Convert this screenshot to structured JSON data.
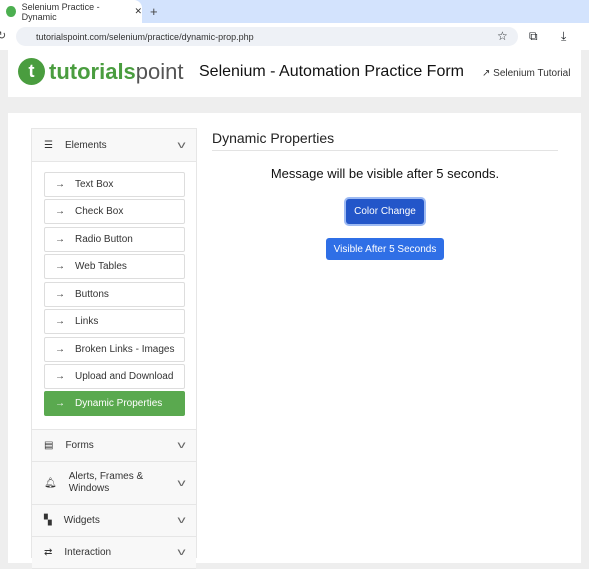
{
  "browser": {
    "tab_title": "Selenium Practice - Dynamic",
    "url": "tutorialspoint.com/selenium/practice/dynamic-prop.php"
  },
  "header": {
    "logo": "tutorialspoint",
    "logo_a": "tutorials",
    "logo_b": "point",
    "title": "Selenium - Automation Practice Form",
    "link": "Selenium Tutorial"
  },
  "sidebar": {
    "sections": [
      {
        "label": "Elements",
        "icon": "menu-icon"
      },
      {
        "label": "Forms",
        "icon": "list-icon"
      },
      {
        "label": "Alerts, Frames & Windows",
        "icon": "bell-icon"
      },
      {
        "label": "Widgets",
        "icon": "widgets-icon"
      },
      {
        "label": "Interaction",
        "icon": "arrows-icon"
      }
    ],
    "items": [
      "Text Box",
      "Check Box",
      "Radio Button",
      "Web Tables",
      "Buttons",
      "Links",
      "Broken Links - Images",
      "Upload and Download",
      "Dynamic Properties"
    ],
    "active": "Dynamic Properties"
  },
  "main": {
    "heading": "Dynamic Properties",
    "message": "Message will be visible after 5 seconds.",
    "color_change": "Color Change",
    "visible_after": "Visible After 5 Seconds"
  },
  "colors": {
    "accent": "#5aa94f",
    "button": "#2f6fe6"
  }
}
